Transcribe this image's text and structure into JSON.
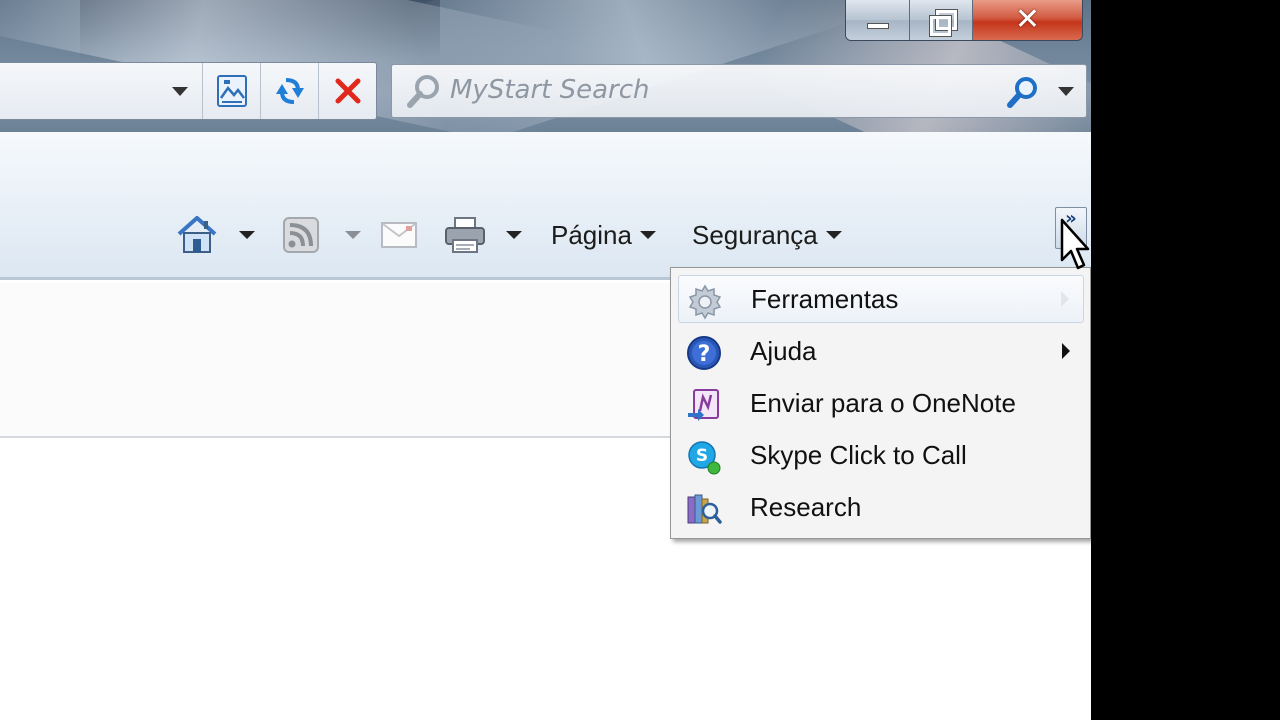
{
  "caption_buttons": {
    "minimize_icon": "minimize-icon",
    "maximize_icon": "restore-icon",
    "close_glyph": "✕"
  },
  "address_bar": {
    "buttons": [
      "compatibility-view-icon",
      "refresh-icon",
      "stop-icon"
    ]
  },
  "search": {
    "placeholder": "MyStart Search"
  },
  "command_bar": {
    "page_label": "Página",
    "security_label": "Segurança",
    "chevron": "»"
  },
  "menu": {
    "items": [
      {
        "label": "Ferramentas",
        "icon": "gear-icon",
        "submenu": true,
        "highlighted": true
      },
      {
        "label": "Ajuda",
        "icon": "help-icon",
        "submenu": true,
        "highlighted": false
      },
      {
        "label": "Enviar para o OneNote",
        "icon": "onenote-icon",
        "submenu": false,
        "highlighted": false
      },
      {
        "label": "Skype Click to Call",
        "icon": "skype-icon",
        "submenu": false,
        "highlighted": false
      },
      {
        "label": "Research",
        "icon": "research-icon",
        "submenu": false,
        "highlighted": false
      }
    ]
  },
  "colors": {
    "close_red": "#c5351b",
    "menu_bg": "#f4f4f4",
    "command_bar_bg": "#eaf1f8",
    "accent_blue": "#1a5bb8"
  }
}
